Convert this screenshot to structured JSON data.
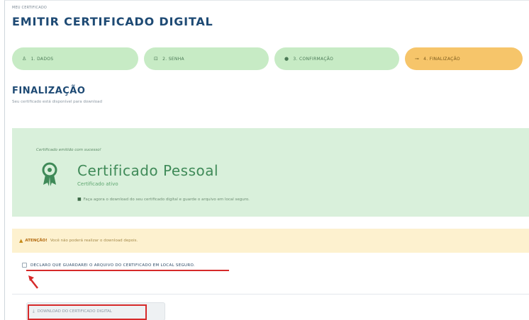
{
  "breadcrumb": "MEU CERTIFICADO",
  "page_title": "EMITIR CERTIFICADO DIGITAL",
  "steps": [
    {
      "number_label": "1. DADOS",
      "icon": "user-icon",
      "glyph": "♙"
    },
    {
      "number_label": "2. SENHA",
      "icon": "lock-icon",
      "glyph": "⊡"
    },
    {
      "number_label": "3. CONFIRMAÇÃO",
      "icon": "check-circle-icon",
      "glyph": "●"
    },
    {
      "number_label": "4. FINALIZAÇÃO",
      "icon": "key-icon",
      "glyph": "⊸"
    }
  ],
  "section": {
    "title": "FINALIZAÇÃO",
    "subtitle": "Seu certificado está disponível para download"
  },
  "certificate": {
    "issued_label": "Certificado emitido com sucesso!",
    "icon": "award-icon",
    "name": "Certificado Pessoal",
    "status": "Certificado ativo",
    "note_icon": "lock-icon",
    "note": "Faça agora o download do seu certificado digital e guarde o arquivo em local seguro."
  },
  "warning": {
    "icon": "warning-icon",
    "label": "ATENÇÃO!",
    "text": "Você não poderá realizar o download depois."
  },
  "declaration": {
    "label": "DECLARO QUE GUARDAREI O ARQUIVO DO CERTIFICADO EM LOCAL SEGURO."
  },
  "download_button": {
    "icon": "download-icon",
    "label": "DOWNLOAD DO CERTIFICADO DIGITAL"
  },
  "colors": {
    "step_done": "#c7ebc5",
    "step_active": "#f6c56a",
    "cert_bg": "#d9f0db",
    "warning_bg": "#fdf1cf",
    "annotation_red": "#d62a2a",
    "title_blue": "#1e4a74"
  }
}
